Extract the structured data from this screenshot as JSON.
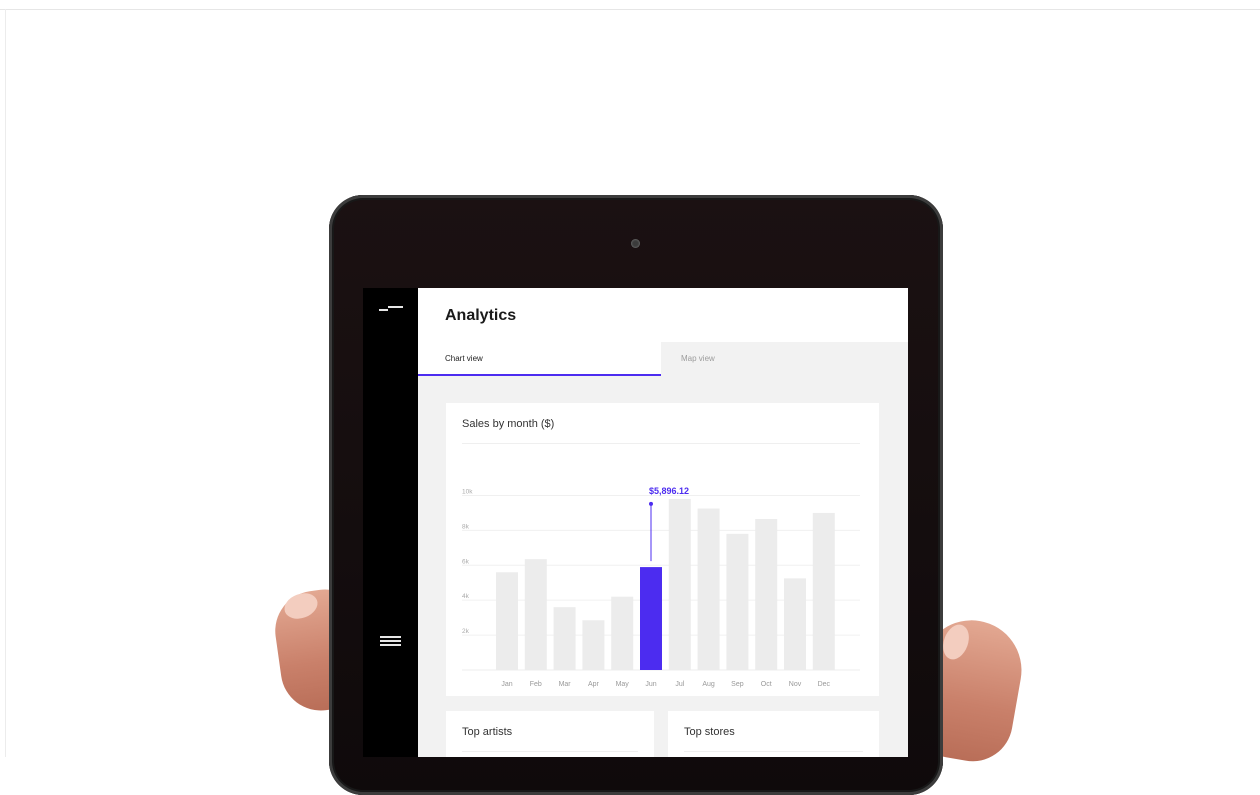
{
  "app": {
    "title": "Analytics"
  },
  "tabs": [
    {
      "label": "Chart view",
      "active": true
    },
    {
      "label": "Map view",
      "active": false
    }
  ],
  "sales_card": {
    "title": "Sales by month ($)"
  },
  "top_artists": {
    "title": "Top artists"
  },
  "top_stores": {
    "title": "Top stores"
  },
  "icons": {
    "logo": "logo-mark-icon",
    "menu": "hamburger-menu-icon"
  },
  "colors": {
    "accent": "#4c2cf0",
    "bar": "#ececec",
    "tablet": "#120c0d"
  },
  "chart_data": {
    "type": "bar",
    "title": "Sales by month ($)",
    "categories": [
      "Jan",
      "Feb",
      "Mar",
      "Apr",
      "May",
      "Jun",
      "Jul",
      "Aug",
      "Sep",
      "Oct",
      "Nov",
      "Dec"
    ],
    "values": [
      5600,
      6350,
      3600,
      2850,
      4200,
      5896.12,
      9800,
      9250,
      7800,
      8650,
      5250,
      9000
    ],
    "y_ticks": [
      "2k",
      "4k",
      "6k",
      "8k",
      "10k"
    ],
    "ylim": [
      0,
      11000
    ],
    "highlight": {
      "category": "Jun",
      "label": "$5,896.12"
    },
    "grid": true
  }
}
